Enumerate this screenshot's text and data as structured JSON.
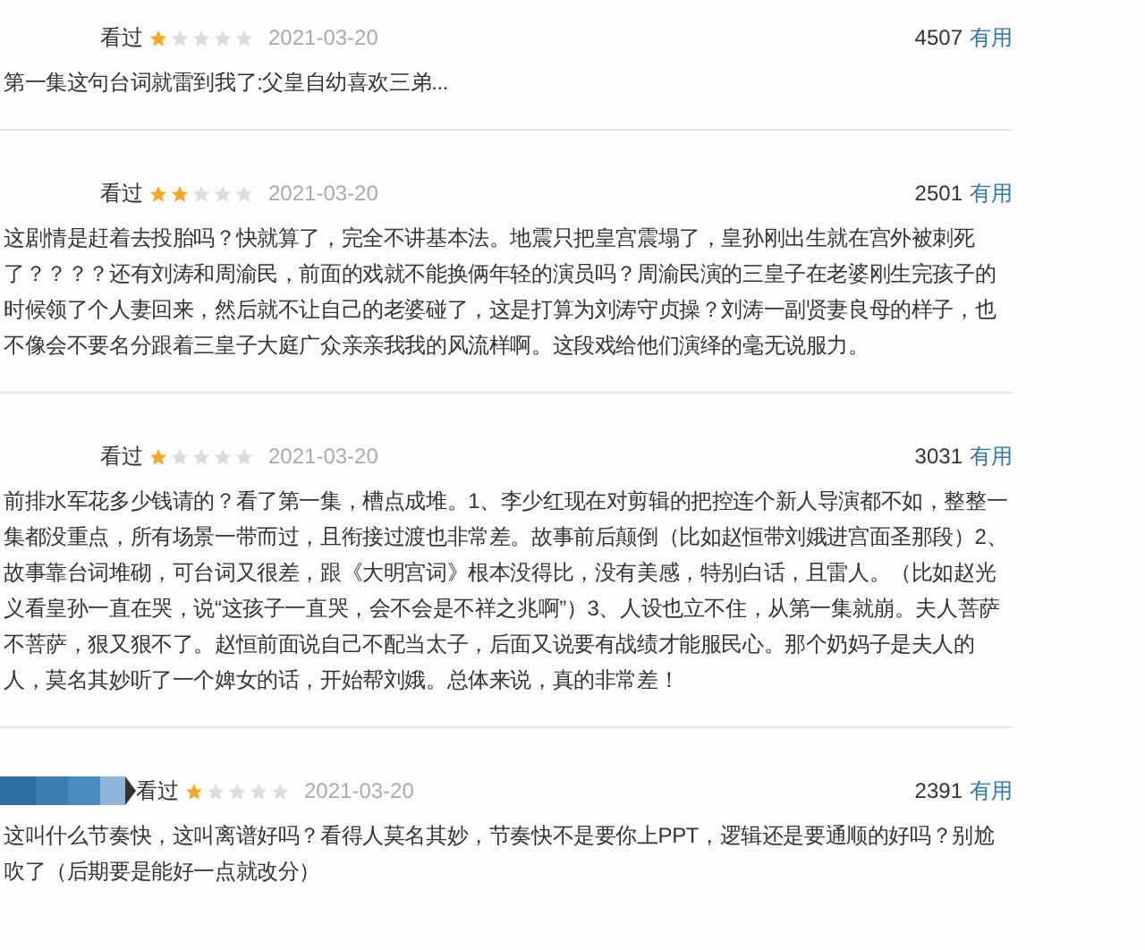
{
  "reviews": [
    {
      "status": "看过",
      "stars": 1,
      "date": "2021-03-20",
      "votes": "4507",
      "vote_label": "有用",
      "text": "第一集这句台词就雷到我了:父皇自幼喜欢三弟..."
    },
    {
      "status": "看过",
      "stars": 2,
      "date": "2021-03-20",
      "votes": "2501",
      "vote_label": "有用",
      "text": "这剧情是赶着去投胎吗？快就算了，完全不讲基本法。地震只把皇宫震塌了，皇孙刚出生就在宫外被刺死了？？？？还有刘涛和周渝民，前面的戏就不能换俩年轻的演员吗？周渝民演的三皇子在老婆刚生完孩子的时候领了个人妻回来，然后就不让自己的老婆碰了，这是打算为刘涛守贞操？刘涛一副贤妻良母的样子，也不像会不要名分跟着三皇子大庭广众亲亲我我的风流样啊。这段戏给他们演绎的毫无说服力。"
    },
    {
      "status": "看过",
      "stars": 1,
      "date": "2021-03-20",
      "votes": "3031",
      "vote_label": "有用",
      "text": "前排水军花多少钱请的？看了第一集，槽点成堆。1、李少红现在对剪辑的把控连个新人导演都不如，整整一集都没重点，所有场景一带而过，且衔接过渡也非常差。故事前后颠倒（比如赵恒带刘娥进宫面圣那段）2、故事靠台词堆砌，可台词又很差，跟《大明宫词》根本没得比，没有美感，特别白话，且雷人。（比如赵光义看皇孙一直在哭，说“这孩子一直哭，会不会是不祥之兆啊”）3、人设也立不住，从第一集就崩。夫人菩萨不菩萨，狠又狠不了。赵恒前面说自己不配当太子，后面又说要有战绩才能服民心。那个奶妈子是夫人的人，莫名其妙听了一个婢女的话，开始帮刘娥。总体来说，真的非常差！"
    },
    {
      "status": "看过",
      "stars": 1,
      "date": "2021-03-20",
      "votes": "2391",
      "vote_label": "有用",
      "text": "这叫什么节奏快，这叫离谱好吗？看得人莫名其妙，节奏快不是要你上PPT，逻辑还是要通顺的好吗？别尬吹了（后期要是能好一点就改分）"
    }
  ]
}
